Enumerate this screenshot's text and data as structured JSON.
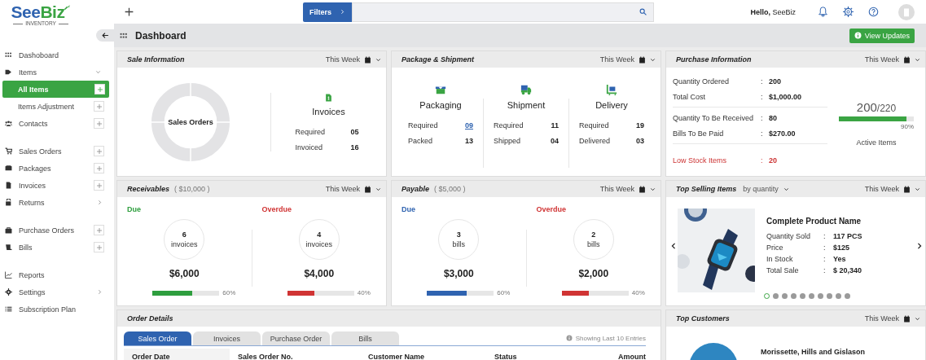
{
  "topbar": {
    "logo_parts": [
      "See",
      "Biz"
    ],
    "logo_subtitle": "INVENTORY",
    "filters_label": "Filters",
    "greeting": "Hello,",
    "user": "SeeBiz"
  },
  "sidebar": {
    "groups": [
      [
        {
          "label": "Dashoboard",
          "selected": false,
          "kind": "plain"
        },
        {
          "label": "Items",
          "selected": false,
          "kind": "plain",
          "expanded": true,
          "children": [
            {
              "label": "All Items",
              "selected": true,
              "kind": "add"
            },
            {
              "label": "Items Adjustment",
              "selected": false,
              "kind": "add"
            }
          ]
        },
        {
          "label": "Contacts",
          "selected": false,
          "kind": "add"
        }
      ],
      [
        {
          "label": "Sales Orders",
          "selected": false,
          "kind": "add"
        },
        {
          "label": "Packages",
          "selected": false,
          "kind": "add"
        },
        {
          "label": "Invoices",
          "selected": false,
          "kind": "add"
        },
        {
          "label": "Returns",
          "selected": false,
          "kind": "more"
        }
      ],
      [
        {
          "label": "Purchase Orders",
          "selected": false,
          "kind": "add"
        },
        {
          "label": "Bills",
          "selected": false,
          "kind": "add"
        }
      ],
      [
        {
          "label": "Reports",
          "selected": false,
          "kind": "plain"
        },
        {
          "label": "Settings",
          "selected": false,
          "kind": "more"
        },
        {
          "label": "Subscription Plan",
          "selected": false,
          "kind": "plain"
        }
      ]
    ]
  },
  "dashboard": {
    "title": "Dashboard",
    "update_button": "View Updates"
  },
  "sale_information": {
    "title": "Sale Information",
    "period": "This Week",
    "donut_label": "Sales Orders",
    "invoices": {
      "title": "Invoices",
      "rows": [
        {
          "label": "Required",
          "value": "05"
        },
        {
          "label": "Invoiced",
          "value": "16"
        }
      ]
    }
  },
  "package_shipment": {
    "title": "Package & Shipment",
    "period": "This Week",
    "columns": [
      {
        "title": "Packaging",
        "rows": [
          {
            "label": "Required",
            "value": "09",
            "kind": "link"
          },
          {
            "label": "Packed",
            "value": "13",
            "kind": "plain"
          }
        ]
      },
      {
        "title": "Shipment",
        "rows": [
          {
            "label": "Required",
            "value": "11",
            "kind": "plain"
          },
          {
            "label": "Shipped",
            "value": "04",
            "kind": "plain"
          }
        ]
      },
      {
        "title": "Delivery",
        "rows": [
          {
            "label": "Required",
            "value": "19",
            "kind": "plain"
          },
          {
            "label": "Delivered",
            "value": "03",
            "kind": "plain"
          }
        ]
      }
    ]
  },
  "purchase_information": {
    "title": "Purchase Information",
    "period": "This Week",
    "groups": [
      [
        {
          "label": "Quantity Ordered",
          "sep": ":",
          "value": "200",
          "kind": "plain"
        },
        {
          "label": "Total Cost",
          "sep": ":",
          "value": "$1,000.00",
          "kind": "plain"
        }
      ],
      [
        {
          "label": "Quantity To Be Received",
          "sep": ":",
          "value": "80",
          "kind": "plain"
        },
        {
          "label": "Bills To Be Paid",
          "sep": ":",
          "value": "$270.00",
          "kind": "plain"
        }
      ],
      [
        {
          "label": "Low Stock Items",
          "sep": ":",
          "value": "20",
          "kind": "alert"
        }
      ]
    ],
    "active_items": {
      "count": "200",
      "total": "/220",
      "level": 0.9,
      "percent": "90%",
      "label": "Active Items"
    }
  },
  "receivables": {
    "title": "Receivables",
    "total": "( $10,000 )",
    "period": "This Week",
    "columns": [
      {
        "status": "Due",
        "color": "#2e9e3e",
        "count": "6",
        "unit": "invoices",
        "amount": "$6,000",
        "level": 0.6,
        "percent": "60%"
      },
      {
        "status": "Overdue",
        "color": "#d03434",
        "count": "4",
        "unit": "invoices",
        "amount": "$4,000",
        "level": 0.4,
        "percent": "40%"
      }
    ]
  },
  "payable": {
    "title": "Payable",
    "total": "( $5,000 )",
    "period": "This Week",
    "columns": [
      {
        "status": "Due",
        "color": "#2f63b0",
        "count": "3",
        "unit": "bills",
        "amount": "$3,000",
        "level": 0.6,
        "percent": "60%"
      },
      {
        "status": "Overdue",
        "color": "#d03434",
        "count": "2",
        "unit": "bills",
        "amount": "$2,000",
        "level": 0.4,
        "percent": "40%"
      }
    ]
  },
  "top_selling_items": {
    "title": "Top Selling Items",
    "sort": "by quantity",
    "period": "This Week",
    "product": {
      "kind": "picture",
      "name": "Complete Product Name",
      "rows": [
        {
          "label": "Quantity Sold",
          "sep": ":",
          "value": "117 PCS"
        },
        {
          "label": "Price",
          "sep": ":",
          "value": "$125"
        },
        {
          "label": "In Stock",
          "sep": ":",
          "value": "Yes"
        },
        {
          "label": "Total Sale",
          "sep": ":",
          "value": "$ 20,340"
        }
      ]
    },
    "pages": [
      {
        "selected": true
      },
      {
        "selected": false
      },
      {
        "selected": false
      },
      {
        "selected": false
      },
      {
        "selected": false
      },
      {
        "selected": false
      },
      {
        "selected": false
      },
      {
        "selected": false
      },
      {
        "selected": false
      },
      {
        "selected": false
      }
    ]
  },
  "order_details": {
    "title": "Order Details",
    "tabs": [
      {
        "label": "Sales Order",
        "selected": true
      },
      {
        "label": "Invoices",
        "selected": false
      },
      {
        "label": "Purchase Order",
        "selected": false
      },
      {
        "label": "Bills",
        "selected": false
      }
    ],
    "note": "Showing Last 10 Entries",
    "columns": [
      "Order Date",
      "Sales Order No.",
      "Customer Name",
      "Status",
      "Amount"
    ]
  },
  "top_customers": {
    "title": "Top Customers",
    "period": "This Week",
    "customer": "Morissette, Hills and Gislason"
  }
}
